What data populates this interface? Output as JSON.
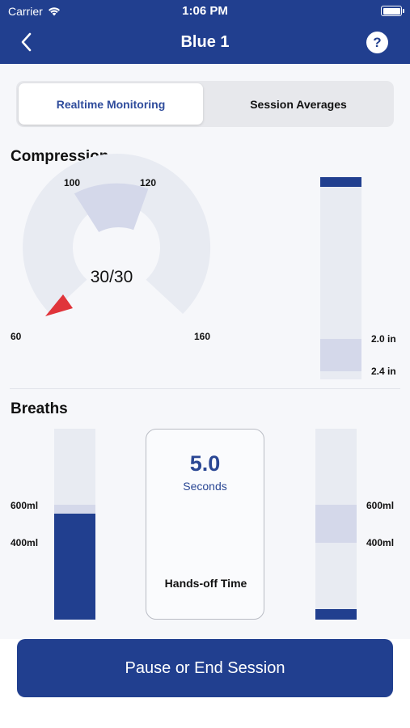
{
  "status_bar": {
    "carrier": "Carrier",
    "time": "1:06 PM"
  },
  "header": {
    "title": "Blue 1",
    "help_label": "?"
  },
  "tabs": [
    {
      "label": "Realtime Monitoring",
      "selected": true
    },
    {
      "label": "Session Averages",
      "selected": false
    }
  ],
  "compression": {
    "title": "Compression",
    "gauge": {
      "value_label": "30/30",
      "ticks": [
        "60",
        "100",
        "120",
        "160"
      ],
      "indicator_color": "#e0343a"
    },
    "depth_labels": [
      "2.0 in",
      "2.4 in"
    ]
  },
  "breaths": {
    "title": "Breaths",
    "left_labels": [
      "600ml",
      "400ml"
    ],
    "right_labels": [
      "600ml",
      "400ml"
    ],
    "hands_off": {
      "value": "5.0",
      "unit": "Seconds",
      "label": "Hands-off Time"
    }
  },
  "footer": {
    "button_label": "Pause or End Session"
  },
  "colors": {
    "brand": "#213f8f",
    "track": "#e8ebf2",
    "target_zone": "#d4d8ea",
    "alert": "#e0343a"
  }
}
